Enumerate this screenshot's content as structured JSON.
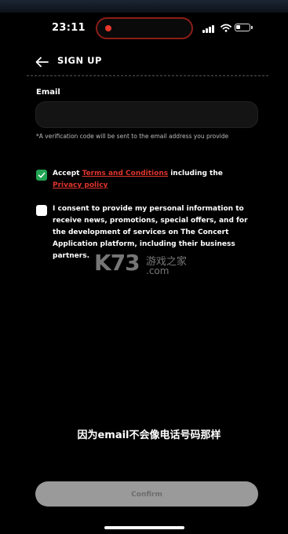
{
  "status_bar": {
    "time": "23:11",
    "battery_level": 0.35,
    "recording_color": "#e8372c"
  },
  "header": {
    "title": "SIGN UP",
    "back_icon": "arrow-left-icon"
  },
  "form": {
    "email_label": "Email",
    "email_value": "",
    "email_placeholder": "",
    "hint": "*A verification code will be sent to the email address you provide"
  },
  "terms": {
    "checked": true,
    "prefix": "Accept ",
    "terms_link": "Terms and Conditions",
    "middle": " including the ",
    "privacy_link": "Privacy policy"
  },
  "marketing": {
    "checked": false,
    "text": "I consent to provide my personal information to receive news, promotions, special offers, and for the development of services on The Concert Application platform, including their business partners."
  },
  "watermark": {
    "main": "K73",
    "cn": "游戏之家",
    "domain": ".com"
  },
  "caption": "因为email不会像电话号码那样",
  "confirm_label": "Confirm",
  "colors": {
    "accent_link": "#e0342d",
    "check_on": "#21a453",
    "button_bg": "#9a9a9a"
  }
}
